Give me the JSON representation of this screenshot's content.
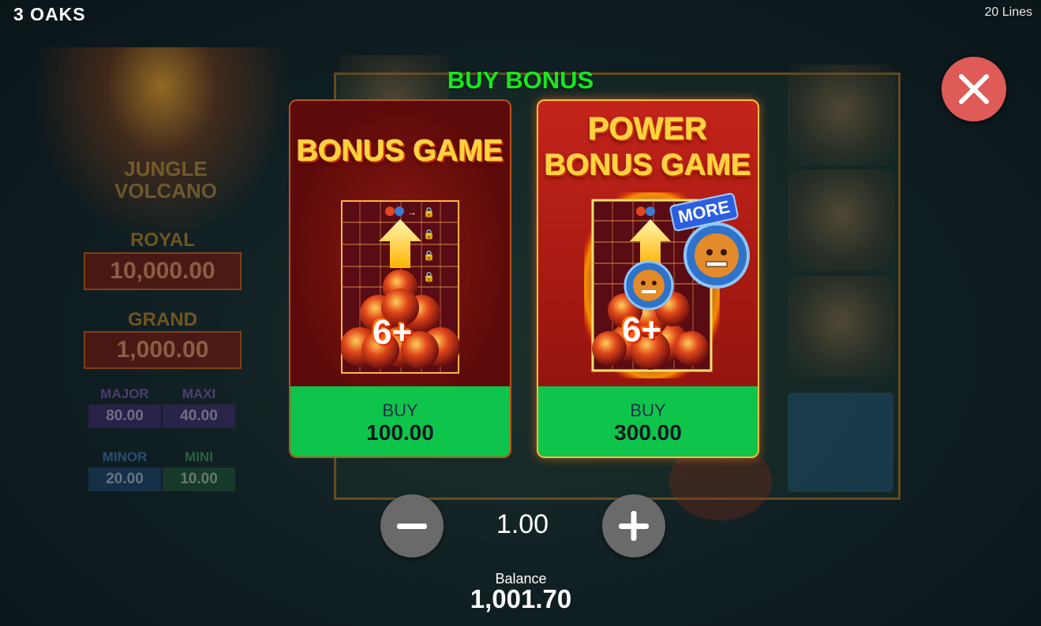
{
  "brand": "3 OAKS",
  "lines_text": "20 Lines",
  "modal": {
    "title": "BUY BONUS",
    "close_icon": "close-icon"
  },
  "options": [
    {
      "title_line1": "BONUS GAME",
      "title_line2": "",
      "badge": "6+",
      "buy_label": "BUY",
      "price": "100.00"
    },
    {
      "title_line1": "POWER",
      "title_line2": "BONUS GAME",
      "badge": "6+",
      "extra_badge": "MORE",
      "buy_label": "BUY",
      "price": "300.00"
    }
  ],
  "bet": {
    "value": "1.00",
    "decrease_icon": "minus-icon",
    "increase_icon": "plus-icon"
  },
  "balance": {
    "label": "Balance",
    "value": "1,001.70"
  },
  "background": {
    "logo_line1": "JUNGLE",
    "logo_line2": "VOLCANO",
    "jackpots": {
      "royal": {
        "label": "ROYAL",
        "value": "10,000.00"
      },
      "grand": {
        "label": "GRAND",
        "value": "1,000.00"
      },
      "major": {
        "label": "MAJOR",
        "value": "80.00"
      },
      "maxi": {
        "label": "MAXI",
        "value": "40.00"
      },
      "minor": {
        "label": "MINOR",
        "value": "20.00"
      },
      "mini": {
        "label": "MINI",
        "value": "10.00"
      }
    }
  },
  "colors": {
    "title_green": "#19e61d",
    "buy_green": "#0fc44a",
    "close_red": "#de5b57",
    "card_gold": "#ffd43a"
  }
}
